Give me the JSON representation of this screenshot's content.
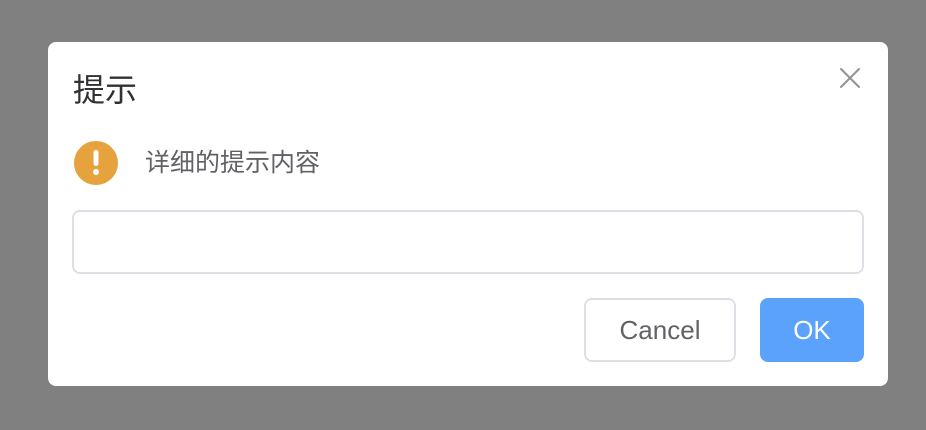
{
  "dialog": {
    "title": "提示",
    "message": "详细的提示内容",
    "input": {
      "value": "",
      "placeholder": ""
    },
    "buttons": {
      "cancel_label": "Cancel",
      "ok_label": "OK"
    },
    "icons": {
      "close": "close-icon",
      "status": "warning-icon"
    }
  },
  "colors": {
    "overlay": "#808080",
    "warning": "#e6a23c",
    "primary": "#5aa2fb",
    "border": "#dcdfe6",
    "title_text": "#303133",
    "body_text": "#606266"
  }
}
